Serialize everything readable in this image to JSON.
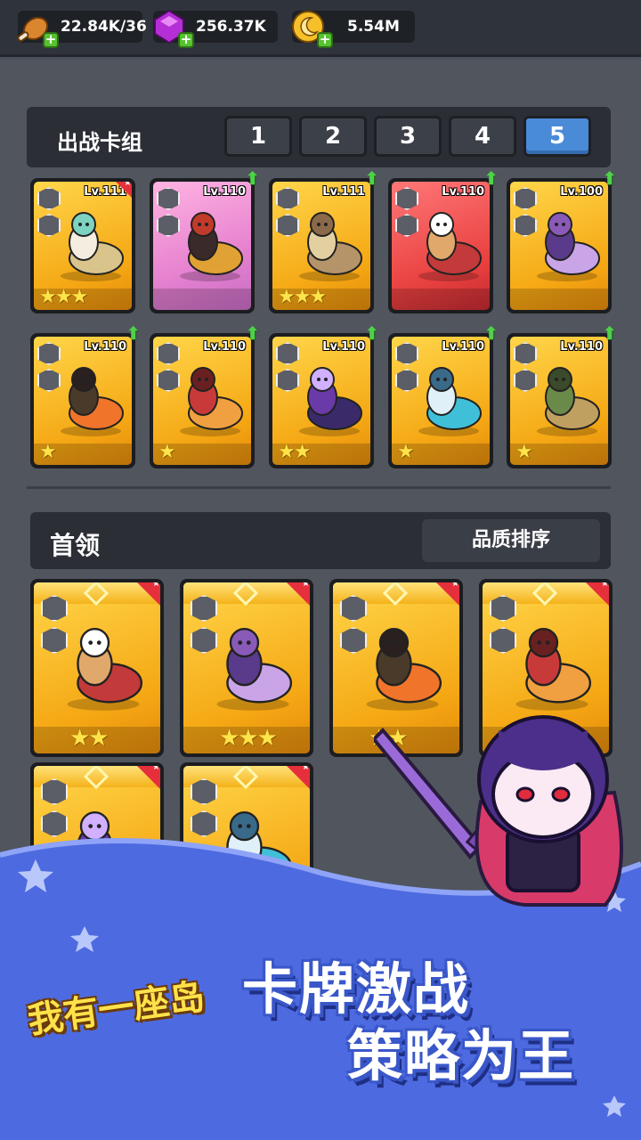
{
  "resources": {
    "food": "22.84K/36",
    "gems": "256.37K",
    "coins": "5.54M",
    "food_icon": "drumstick-icon",
    "gem_icon": "purple-gem-icon",
    "coin_icon": "moon-coin-icon"
  },
  "deck": {
    "title": "出战卡组",
    "tabs": [
      "1",
      "2",
      "3",
      "4",
      "5"
    ],
    "active_tab": "5"
  },
  "deck_cards": [
    {
      "level": "Lv.111",
      "stars": 3,
      "frame": "gold",
      "corner": true,
      "upgrade": false
    },
    {
      "level": "Lv.110",
      "stars": 0,
      "frame": "purple",
      "corner": false,
      "upgrade": true
    },
    {
      "level": "Lv.111",
      "stars": 3,
      "frame": "gold",
      "corner": false,
      "upgrade": true
    },
    {
      "level": "Lv.110",
      "stars": 0,
      "frame": "red",
      "corner": false,
      "upgrade": true
    },
    {
      "level": "Lv.100",
      "stars": 0,
      "frame": "gold",
      "corner": false,
      "upgrade": true
    },
    {
      "level": "Lv.110",
      "stars": 1,
      "frame": "gold",
      "corner": false,
      "upgrade": true
    },
    {
      "level": "Lv.110",
      "stars": 1,
      "frame": "gold",
      "corner": false,
      "upgrade": true
    },
    {
      "level": "Lv.110",
      "stars": 2,
      "frame": "gold",
      "corner": false,
      "upgrade": true
    },
    {
      "level": "Lv.110",
      "stars": 1,
      "frame": "gold",
      "corner": false,
      "upgrade": true
    },
    {
      "level": "Lv.110",
      "stars": 1,
      "frame": "gold",
      "corner": false,
      "upgrade": true
    }
  ],
  "leaders": {
    "title": "首领",
    "sort_label": "品质排序",
    "cards": [
      {
        "stars": 2
      },
      {
        "stars": 3
      },
      {
        "stars": 2
      },
      {
        "stars": 0
      },
      {
        "stars": 0
      },
      {
        "stars": 0
      }
    ]
  },
  "promo": {
    "line1": "卡牌激战",
    "line2": "策略为王",
    "logo": "我有一座岛"
  },
  "colors": {
    "accent_blue": "#4a8bd8",
    "promo_blue": "#4e6ae0",
    "gold": "#f5a814"
  }
}
